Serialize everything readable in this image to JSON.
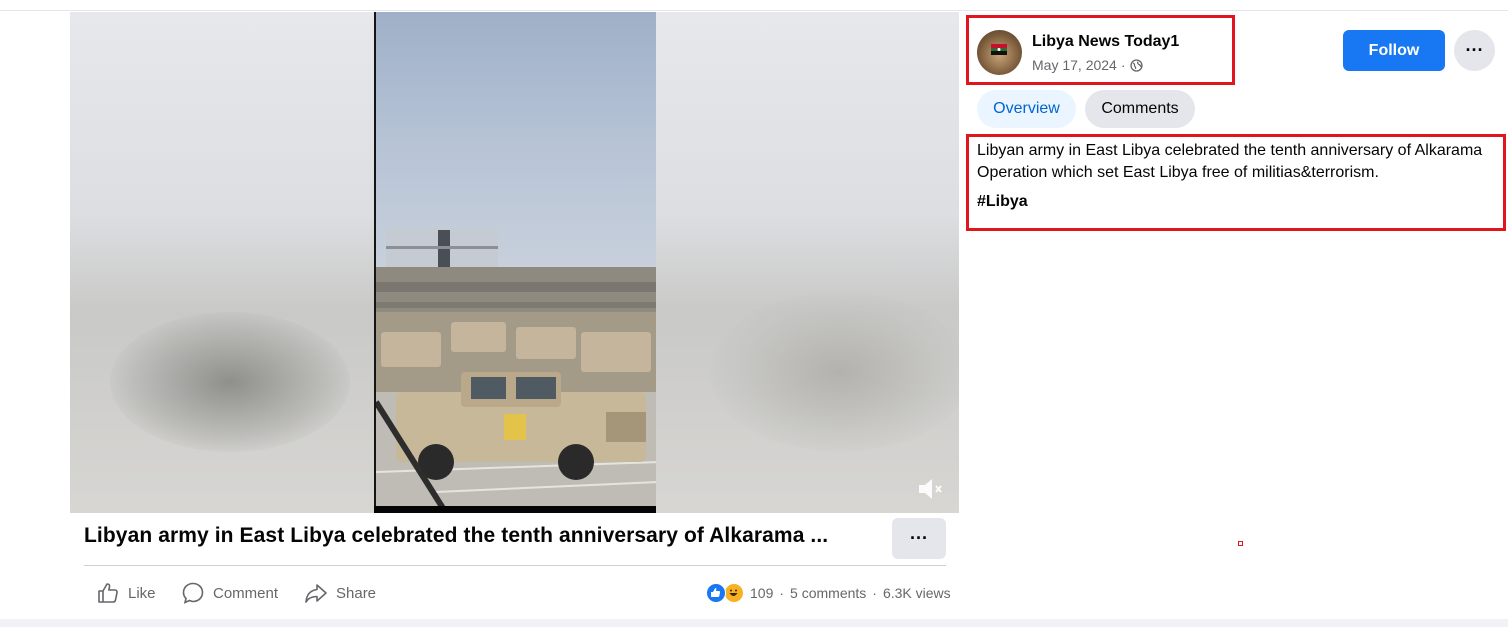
{
  "video": {
    "mute_icon": "muted-speaker-icon"
  },
  "post": {
    "title": "Libyan army in East Libya celebrated the tenth anniversary of Alkarama ...",
    "more_label": "···",
    "actions": {
      "like": "Like",
      "comment": "Comment",
      "share": "Share"
    },
    "stats": {
      "reaction_count": "109",
      "comments": "5 comments",
      "views": "6.3K views",
      "separator": "·"
    }
  },
  "sidebar": {
    "page_name": "Libya News Today1",
    "date": "May 17, 2024",
    "date_separator": "·",
    "audience_icon": "globe-icon",
    "follow_label": "Follow",
    "more_label": "···",
    "tabs": [
      {
        "label": "Overview",
        "active": true
      },
      {
        "label": "Comments",
        "active": false
      }
    ],
    "description": "Libyan army in East Libya celebrated the tenth anniversary of Alkarama Operation which set East Libya free of militias&terrorism.",
    "hashtag": "#Libya"
  },
  "colors": {
    "accent": "#1877f2",
    "highlight_box": "#e0151e",
    "secondary_text": "#65676b"
  }
}
